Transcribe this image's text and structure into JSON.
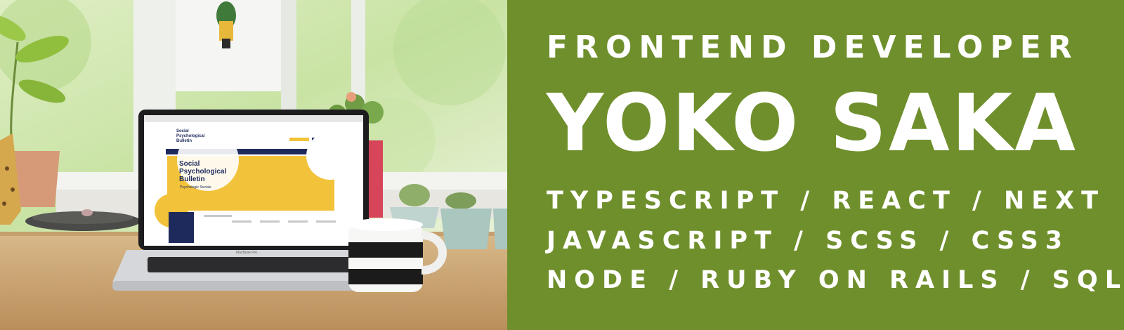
{
  "colors": {
    "panel": "#6f8f2c",
    "text": "#ffffff",
    "journal_yellow": "#f2c23a",
    "journal_navy": "#1f2a5c"
  },
  "banner": {
    "role": "FRONTEND DEVELOPER",
    "name": "YOKO SAKA",
    "stack_lines": [
      "TYPESCRIPT / REACT / NEXT",
      "JAVASCRIPT / SCSS / CSS3",
      "NODE / RUBY ON RAILS / SQL"
    ]
  },
  "photo": {
    "screen_header_title": [
      "Social",
      "Psychological",
      "Bulletin"
    ],
    "screen_hero_title": [
      "Social",
      "Psychological",
      "Bulletin"
    ],
    "screen_hero_subtitle": "Psychologie Sociale",
    "laptop_label": "MacBook Pro"
  }
}
